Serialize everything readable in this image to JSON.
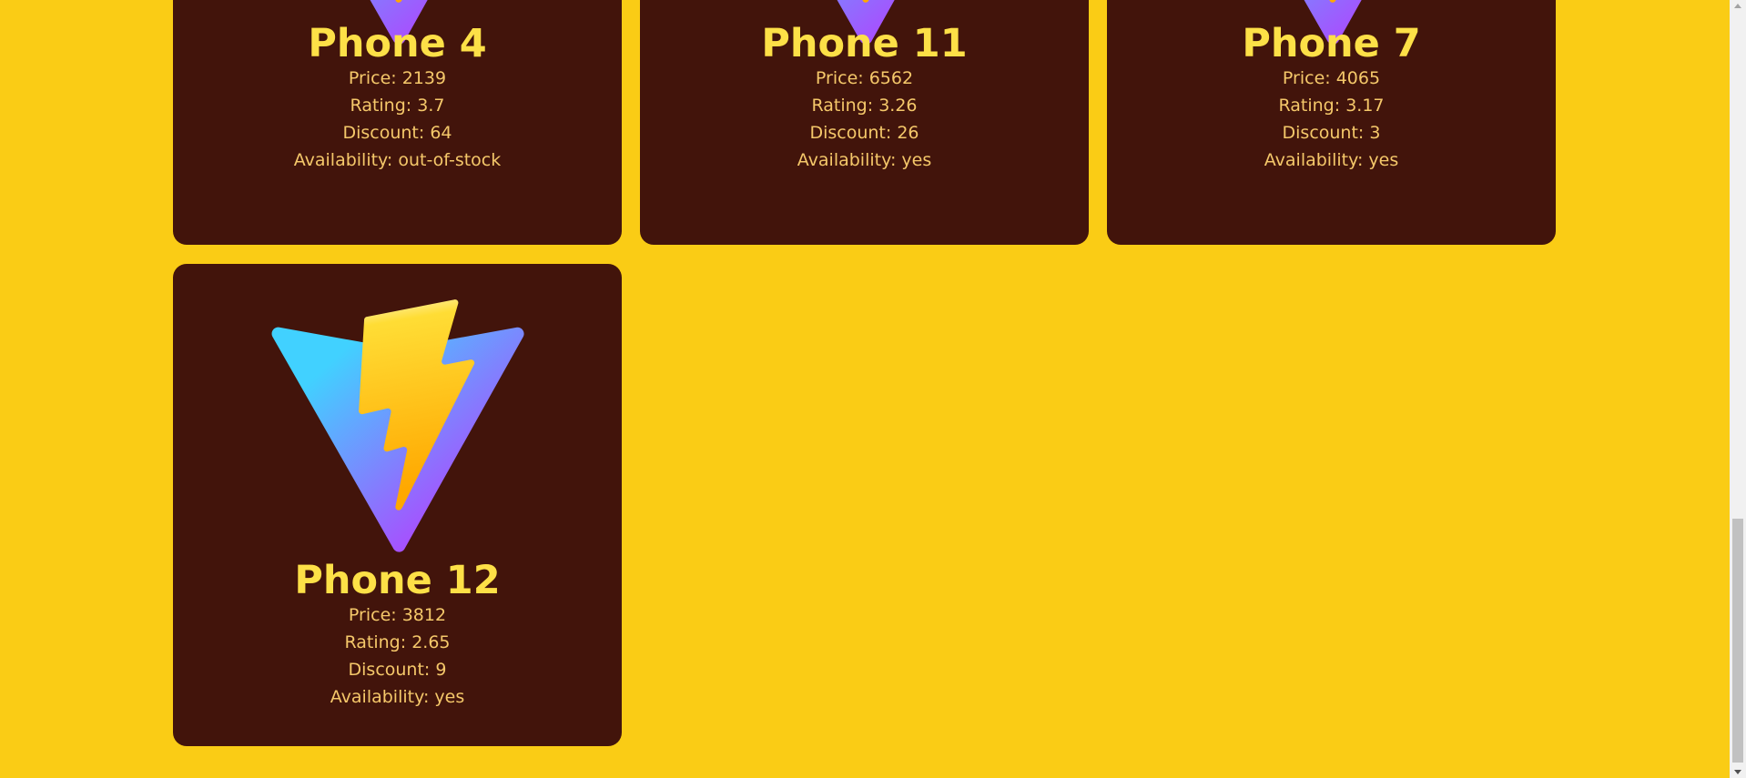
{
  "colors": {
    "background": "#facc15",
    "card": "#42140b",
    "title": "#fde047",
    "text": "#f5c86a"
  },
  "labels": {
    "price": "Price: ",
    "rating": "Rating: ",
    "discount": "Discount: ",
    "availability": "Availability: "
  },
  "products": [
    {
      "name": "Phone 4",
      "price": "2139",
      "rating": "3.7",
      "discount": "64",
      "availability": "out-of-stock"
    },
    {
      "name": "Phone 11",
      "price": "6562",
      "rating": "3.26",
      "discount": "26",
      "availability": "yes"
    },
    {
      "name": "Phone 7",
      "price": "4065",
      "rating": "3.17",
      "discount": "3",
      "availability": "yes"
    },
    {
      "name": "Phone 12",
      "price": "3812",
      "rating": "2.65",
      "discount": "9",
      "availability": "yes"
    }
  ],
  "icons": {
    "product_logo": "vite-lightning-logo-icon"
  }
}
